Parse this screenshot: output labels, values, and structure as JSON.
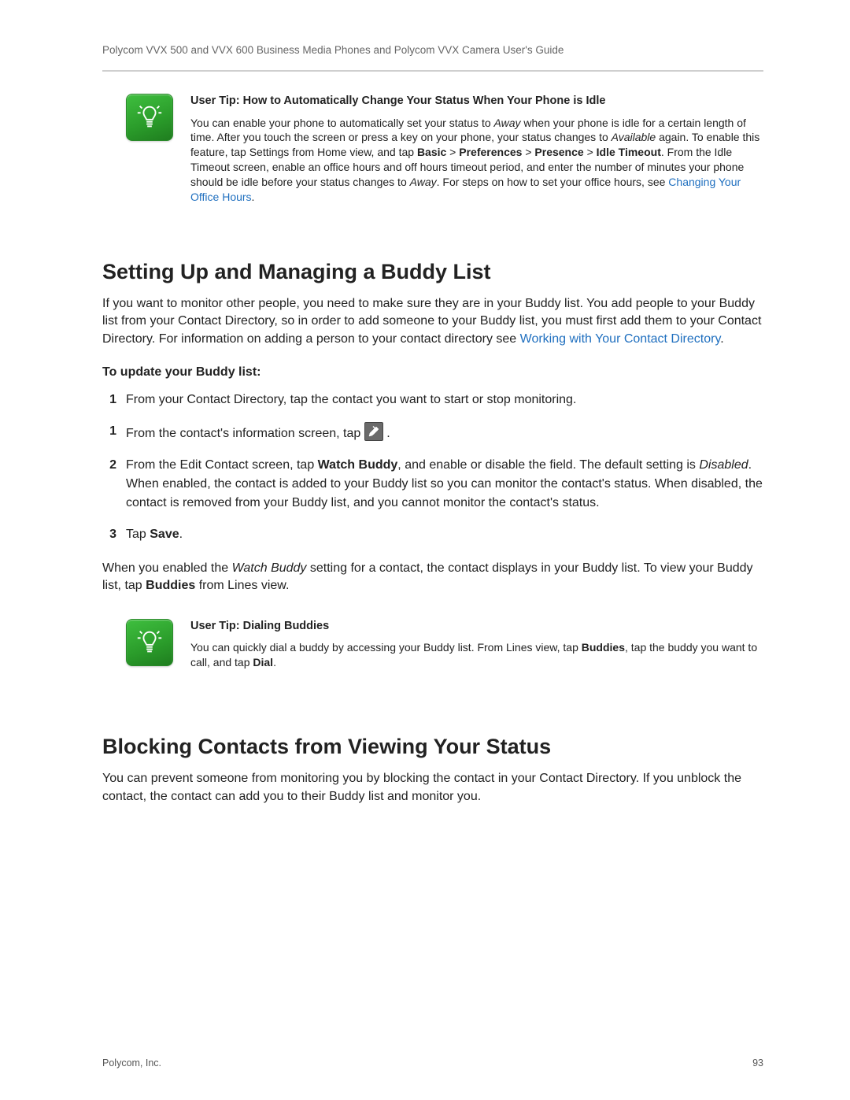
{
  "header": {
    "doc_title": "Polycom VVX 500 and VVX 600 Business Media Phones and Polycom VVX Camera User's Guide"
  },
  "tip1": {
    "title": "User Tip: How to Automatically Change Your Status When Your Phone is Idle",
    "body_1": "You can enable your phone to automatically set your status to ",
    "away": "Away",
    "body_2": " when your phone is idle for a certain length of time. After you touch the screen or press a key on your phone, your status changes to ",
    "available": "Available",
    "body_3": " again. To enable this feature, tap Settings from Home view, and tap ",
    "basic": "Basic",
    "gt1": " > ",
    "preferences": "Preferences",
    "gt2": " > ",
    "presence": "Presence",
    "gt3": " > ",
    "idle_timeout": "Idle Timeout",
    "body_4": ". From the Idle Timeout screen, enable an office hours and off hours timeout period, and enter the number of minutes your phone should be idle before your status changes to ",
    "away2": "Away",
    "body_5": ". For steps on how to set your office hours, see ",
    "link": "Changing Your Office Hours",
    "body_6": "."
  },
  "section1": {
    "heading": "Setting Up and Managing a Buddy List",
    "para1_a": "If you want to monitor other people, you need to make sure they are in your Buddy list. You add people to your Buddy list from your Contact Directory, so in order to add someone to your Buddy list, you must first add them to your Contact Directory. For information on adding a person to your contact directory see ",
    "para1_link": "Working with Your Contact Directory",
    "para1_b": ".",
    "subhead": "To update your Buddy list:",
    "step1_num": "1",
    "step1": "From your Contact Directory, tap the contact you want to start or stop monitoring.",
    "step2_num": "1",
    "step2_a": "From the contact's information screen, tap ",
    "step2_icon": "edit-icon",
    "step2_b": " .",
    "step3_num": "2",
    "step3_a": "From the Edit Contact screen, tap ",
    "watch_buddy": "Watch Buddy",
    "step3_b": ", and enable or disable the field. The default setting is ",
    "disabled": "Disabled",
    "step3_c": ". When enabled, the contact is added to your Buddy list so you can monitor the contact's status. When disabled, the contact is removed from your Buddy list, and you cannot monitor the contact's status.",
    "step4_num": "3",
    "step4_a": "Tap ",
    "save": "Save",
    "step4_b": ".",
    "after_a": "When you enabled the ",
    "after_wb": "Watch Buddy",
    "after_b": " setting for a contact, the contact displays in your Buddy list. To view your Buddy list, tap ",
    "buddies": "Buddies",
    "after_c": " from Lines view."
  },
  "tip2": {
    "title": "User Tip: Dialing Buddies",
    "body_a": "You can quickly dial a buddy by accessing your Buddy list. From Lines view, tap ",
    "buddies": "Buddies",
    "body_b": ", tap the buddy you want to call, and tap ",
    "dial": "Dial",
    "body_c": "."
  },
  "section2": {
    "heading": "Blocking Contacts from Viewing Your Status",
    "para": "You can prevent someone from monitoring you by blocking the contact in your Contact Directory. If you unblock the contact, the contact can add you to their Buddy list and monitor you."
  },
  "footer": {
    "left": "Polycom, Inc.",
    "right": "93"
  }
}
